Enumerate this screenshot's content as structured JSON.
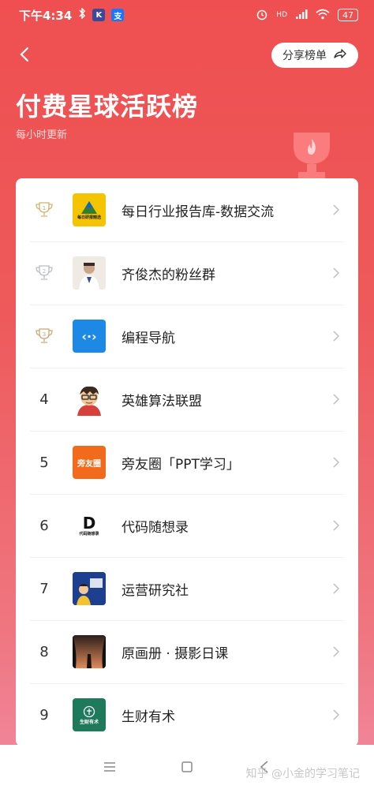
{
  "status_bar": {
    "time": "下午4:34",
    "app_badge_k": "K",
    "app_badge_pay": "支",
    "signal_label": "HD",
    "battery": "47"
  },
  "header": {
    "share_label": "分享榜单",
    "title": "付费星球活跃榜",
    "subtitle": "每小时更新"
  },
  "ranking": [
    {
      "rank": "1",
      "name": "每日行业报告库-数据交流",
      "avatar_text": "每日研报精选",
      "avatar_bg": "#f5c400"
    },
    {
      "rank": "2",
      "name": "齐俊杰的粉丝群",
      "avatar_text": "",
      "avatar_bg": "#d9d4cf"
    },
    {
      "rank": "3",
      "name": "编程导航",
      "avatar_text": "‹·›",
      "avatar_bg": "#1e88e5"
    },
    {
      "rank": "4",
      "name": "英雄算法联盟",
      "avatar_text": "",
      "avatar_bg": "#ffffff"
    },
    {
      "rank": "5",
      "name": "旁友圈「PPT学习」",
      "avatar_text": "旁友圈",
      "avatar_bg": "#f26a1b"
    },
    {
      "rank": "6",
      "name": "代码随想录",
      "avatar_text": "代码随想录",
      "avatar_bg": "#ffffff"
    },
    {
      "rank": "7",
      "name": "运营研究社",
      "avatar_text": "",
      "avatar_bg": "#1d3f8f"
    },
    {
      "rank": "8",
      "name": "原画册 · 摄影日课",
      "avatar_text": "",
      "avatar_bg": "#3b2c28"
    },
    {
      "rank": "9",
      "name": "生财有术",
      "avatar_text": "生财有术",
      "avatar_bg": "#1e7a5a"
    }
  ],
  "watermark": "知乎 @小金的学习笔记",
  "colors": {
    "accent": "#ef4f50",
    "gold": "#d2b070",
    "silver": "#b8bcc4",
    "bronze": "#c9a774"
  }
}
